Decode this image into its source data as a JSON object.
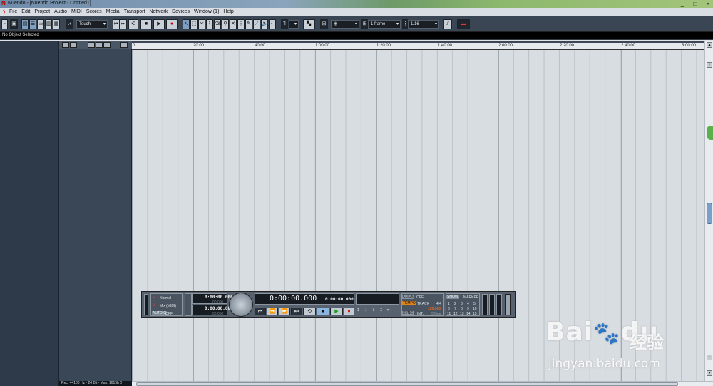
{
  "window": {
    "title": "Nuendo - [Nuendo Project - Untitled1]",
    "controls": [
      "_",
      "□",
      "×"
    ]
  },
  "menubar": {
    "items": [
      "File",
      "Edit",
      "Project",
      "Audio",
      "MIDI",
      "Scores",
      "Media",
      "Transport",
      "Network",
      "Devices",
      "Window (1)",
      "Help"
    ]
  },
  "toolbar": {
    "automation_mode": "Touch",
    "grid_type": "1 frame",
    "quantize": "1/16",
    "nudge_value": "-"
  },
  "infobar": {
    "status": "No Object Selected"
  },
  "ruler": {
    "labels": [
      "0",
      "20:00",
      "40:00",
      "1:00:00",
      "1:20:00",
      "1:40:00",
      "2:00:00",
      "2:20:00",
      "2:40:00",
      "3:00:00"
    ]
  },
  "statusbar": {
    "text": "Rec: 44100 Hz - 24 Bit - Max: 1615h 0"
  },
  "transport": {
    "record_mode": "Normal",
    "cycle_mode": "Mix (MIDI)",
    "auto_label": "AUTO Q",
    "auto_value": "OFF",
    "left_locator": "0:00:00.000",
    "left_locator_sub": "00.000",
    "right_locator": "0:00:00.000",
    "right_locator_sub": "00.000",
    "main_time": "0:00:00.000",
    "secondary_time": "0:00:00.000",
    "click_label": "CLICK",
    "click_value": "OFF",
    "tempo_label": "TEMPO",
    "tempo_mode": "TRACK",
    "signature": "4/4",
    "tempo_value": "120.000",
    "sync_label": "SYNC",
    "sync_mode": "INT.",
    "sync_status": "Offline",
    "show_label": "SHOW",
    "marker_label": "MARKER",
    "markers": [
      "1",
      "2",
      "3",
      "4",
      "5",
      "6",
      "7",
      "8",
      "9",
      "10",
      "11",
      "12",
      "13",
      "14",
      "15"
    ]
  },
  "watermark": {
    "brand": "Bai",
    "brand2": "du",
    "chinese": "经验",
    "url": "jingyan.baidu.com"
  },
  "colors": {
    "toolbar_bg": "#3b4654",
    "arrange_bg": "#d8dde1",
    "tempo_orange": "#e0861c",
    "tempo_value_color": "#e06a2a",
    "active_tool": "#7f9fc2"
  }
}
